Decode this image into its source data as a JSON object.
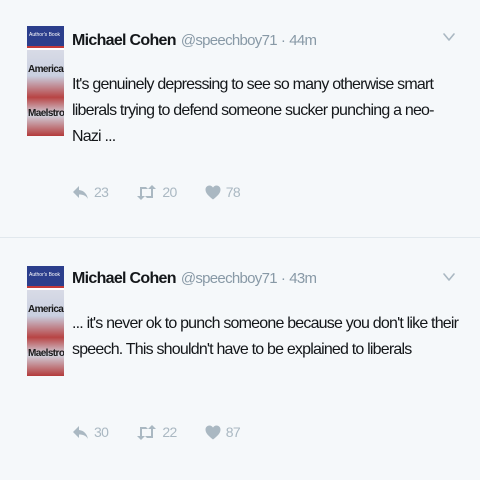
{
  "tweets": [
    {
      "avatar_text": {
        "top": "Author's Book",
        "line1": "American",
        "line2": "Maelstrom"
      },
      "name": "Michael Cohen",
      "handle": "@speechboy71",
      "separator": "·",
      "time": "44m",
      "text": "It's genuinely depressing to see so many otherwise smart liberals trying to defend someone sucker punching a neo-Nazi ...",
      "replies": "23",
      "retweets": "20",
      "likes": "78"
    },
    {
      "avatar_text": {
        "top": "Author's Book",
        "line1": "American",
        "line2": "Maelstrom"
      },
      "name": "Michael Cohen",
      "handle": "@speechboy71",
      "separator": "·",
      "time": "43m",
      "text": "... it's never ok to punch someone because you don't like their speech. This shouldn't have to be explained to liberals",
      "replies": "30",
      "retweets": "22",
      "likes": "87"
    }
  ],
  "icons": {
    "reply": "reply-icon",
    "retweet": "retweet-icon",
    "like": "heart-icon",
    "menu": "chevron-down-icon"
  },
  "colors": {
    "background": "#f5f8fa",
    "text": "#14171a",
    "muted": "#8899a6",
    "icon": "#aab8c2"
  }
}
